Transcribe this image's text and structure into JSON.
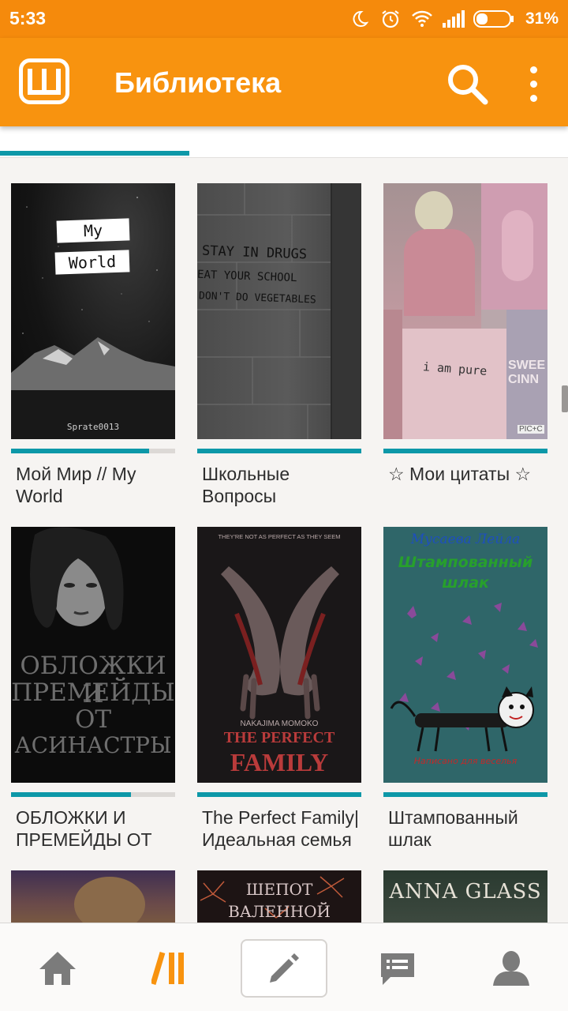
{
  "status_bar": {
    "time": "5:33",
    "battery_percent": "31%",
    "icons": [
      "moon-icon",
      "alarm-icon",
      "wifi-icon",
      "signal-icon",
      "battery-icon"
    ]
  },
  "app_bar": {
    "logo_letter": "Ш",
    "title": "Библиотека",
    "icons": [
      "search-icon",
      "more-vert-icon"
    ]
  },
  "colors": {
    "primary": "#f8930f",
    "status_bar": "#f58a0c",
    "accent_teal": "#0d98a8",
    "background": "#f6f4f2"
  },
  "books": [
    {
      "title": "Мой Мир // My World",
      "progress": 0.84,
      "cover_texts": [
        "My",
        "World",
        "Sprate0013"
      ]
    },
    {
      "title": "Школьные Вопросы",
      "progress": 1.0,
      "cover_texts": [
        "STAY IN DRUGS",
        "EAT YOUR SCHOOL",
        "DON'T DO VEGETABLES"
      ]
    },
    {
      "title": "☆ Мои цитаты ☆",
      "progress": 1.0,
      "cover_texts": [
        "i am pure",
        "SWEE",
        "CINN",
        "PIC+C"
      ]
    },
    {
      "title": "ОБЛОЖКИ И ПРЕМЕЙДЫ ОТ А...",
      "progress": 0.73,
      "cover_texts": [
        "ОБЛОЖКИ И",
        "ПРЕМЕЙДЫ",
        "ОТ",
        "АСИНАСТРЫ"
      ]
    },
    {
      "title": "The Perfect Family| Идеальная семья",
      "progress": 1.0,
      "cover_texts": [
        "THEY'RE NOT AS PERFECT AS THEY SEEM",
        "NAKAJIMA MOMOKO",
        "THE PERFECT",
        "FAMILY"
      ]
    },
    {
      "title": "Штампованный шлак",
      "progress": 1.0,
      "cover_texts": [
        "Мусаева Лейла",
        "Штампованный",
        "шлак",
        "Написано для веселья"
      ]
    },
    {
      "title": "",
      "progress": 0,
      "cover_texts": []
    },
    {
      "title": "",
      "progress": 0,
      "cover_texts": [
        "ШЕПОТ",
        "ВАЛЕННОЙ"
      ]
    },
    {
      "title": "",
      "progress": 0,
      "cover_texts": [
        "ANNA GLASS"
      ]
    }
  ],
  "bottom_nav": {
    "items": [
      "home-icon",
      "library-icon",
      "write-icon",
      "messages-icon",
      "profile-icon"
    ],
    "active": "library-icon"
  }
}
